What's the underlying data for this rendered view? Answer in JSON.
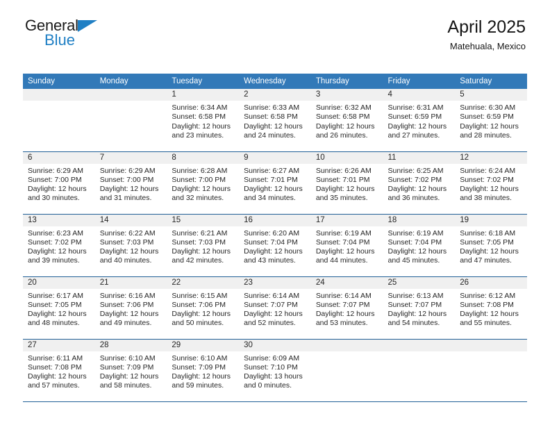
{
  "brand": {
    "name_top": "General",
    "name_bottom": "Blue",
    "color_dark": "#1a1a1a",
    "color_blue": "#1f7fc4"
  },
  "header": {
    "title": "April 2025",
    "subtitle": "Matehuala, Mexico"
  },
  "theme": {
    "header_row_bg": "#3279b8",
    "week_divider": "#205f96",
    "daynum_band_bg": "#f0f0f0",
    "text": "#252525"
  },
  "weekday_headers": [
    "Sunday",
    "Monday",
    "Tuesday",
    "Wednesday",
    "Thursday",
    "Friday",
    "Saturday"
  ],
  "labels": {
    "sunrise_prefix": "Sunrise:",
    "sunset_prefix": "Sunset:",
    "daylight_prefix": "Daylight:"
  },
  "weeks": [
    [
      {
        "day": "",
        "empty": true
      },
      {
        "day": "",
        "empty": true
      },
      {
        "day": "1",
        "sunrise": "Sunrise: 6:34 AM",
        "sunset": "Sunset: 6:58 PM",
        "daylight_line1": "Daylight: 12 hours",
        "daylight_line2": "and 23 minutes."
      },
      {
        "day": "2",
        "sunrise": "Sunrise: 6:33 AM",
        "sunset": "Sunset: 6:58 PM",
        "daylight_line1": "Daylight: 12 hours",
        "daylight_line2": "and 24 minutes."
      },
      {
        "day": "3",
        "sunrise": "Sunrise: 6:32 AM",
        "sunset": "Sunset: 6:58 PM",
        "daylight_line1": "Daylight: 12 hours",
        "daylight_line2": "and 26 minutes."
      },
      {
        "day": "4",
        "sunrise": "Sunrise: 6:31 AM",
        "sunset": "Sunset: 6:59 PM",
        "daylight_line1": "Daylight: 12 hours",
        "daylight_line2": "and 27 minutes."
      },
      {
        "day": "5",
        "sunrise": "Sunrise: 6:30 AM",
        "sunset": "Sunset: 6:59 PM",
        "daylight_line1": "Daylight: 12 hours",
        "daylight_line2": "and 28 minutes."
      }
    ],
    [
      {
        "day": "6",
        "sunrise": "Sunrise: 6:29 AM",
        "sunset": "Sunset: 7:00 PM",
        "daylight_line1": "Daylight: 12 hours",
        "daylight_line2": "and 30 minutes."
      },
      {
        "day": "7",
        "sunrise": "Sunrise: 6:29 AM",
        "sunset": "Sunset: 7:00 PM",
        "daylight_line1": "Daylight: 12 hours",
        "daylight_line2": "and 31 minutes."
      },
      {
        "day": "8",
        "sunrise": "Sunrise: 6:28 AM",
        "sunset": "Sunset: 7:00 PM",
        "daylight_line1": "Daylight: 12 hours",
        "daylight_line2": "and 32 minutes."
      },
      {
        "day": "9",
        "sunrise": "Sunrise: 6:27 AM",
        "sunset": "Sunset: 7:01 PM",
        "daylight_line1": "Daylight: 12 hours",
        "daylight_line2": "and 34 minutes."
      },
      {
        "day": "10",
        "sunrise": "Sunrise: 6:26 AM",
        "sunset": "Sunset: 7:01 PM",
        "daylight_line1": "Daylight: 12 hours",
        "daylight_line2": "and 35 minutes."
      },
      {
        "day": "11",
        "sunrise": "Sunrise: 6:25 AM",
        "sunset": "Sunset: 7:02 PM",
        "daylight_line1": "Daylight: 12 hours",
        "daylight_line2": "and 36 minutes."
      },
      {
        "day": "12",
        "sunrise": "Sunrise: 6:24 AM",
        "sunset": "Sunset: 7:02 PM",
        "daylight_line1": "Daylight: 12 hours",
        "daylight_line2": "and 38 minutes."
      }
    ],
    [
      {
        "day": "13",
        "sunrise": "Sunrise: 6:23 AM",
        "sunset": "Sunset: 7:02 PM",
        "daylight_line1": "Daylight: 12 hours",
        "daylight_line2": "and 39 minutes."
      },
      {
        "day": "14",
        "sunrise": "Sunrise: 6:22 AM",
        "sunset": "Sunset: 7:03 PM",
        "daylight_line1": "Daylight: 12 hours",
        "daylight_line2": "and 40 minutes."
      },
      {
        "day": "15",
        "sunrise": "Sunrise: 6:21 AM",
        "sunset": "Sunset: 7:03 PM",
        "daylight_line1": "Daylight: 12 hours",
        "daylight_line2": "and 42 minutes."
      },
      {
        "day": "16",
        "sunrise": "Sunrise: 6:20 AM",
        "sunset": "Sunset: 7:04 PM",
        "daylight_line1": "Daylight: 12 hours",
        "daylight_line2": "and 43 minutes."
      },
      {
        "day": "17",
        "sunrise": "Sunrise: 6:19 AM",
        "sunset": "Sunset: 7:04 PM",
        "daylight_line1": "Daylight: 12 hours",
        "daylight_line2": "and 44 minutes."
      },
      {
        "day": "18",
        "sunrise": "Sunrise: 6:19 AM",
        "sunset": "Sunset: 7:04 PM",
        "daylight_line1": "Daylight: 12 hours",
        "daylight_line2": "and 45 minutes."
      },
      {
        "day": "19",
        "sunrise": "Sunrise: 6:18 AM",
        "sunset": "Sunset: 7:05 PM",
        "daylight_line1": "Daylight: 12 hours",
        "daylight_line2": "and 47 minutes."
      }
    ],
    [
      {
        "day": "20",
        "sunrise": "Sunrise: 6:17 AM",
        "sunset": "Sunset: 7:05 PM",
        "daylight_line1": "Daylight: 12 hours",
        "daylight_line2": "and 48 minutes."
      },
      {
        "day": "21",
        "sunrise": "Sunrise: 6:16 AM",
        "sunset": "Sunset: 7:06 PM",
        "daylight_line1": "Daylight: 12 hours",
        "daylight_line2": "and 49 minutes."
      },
      {
        "day": "22",
        "sunrise": "Sunrise: 6:15 AM",
        "sunset": "Sunset: 7:06 PM",
        "daylight_line1": "Daylight: 12 hours",
        "daylight_line2": "and 50 minutes."
      },
      {
        "day": "23",
        "sunrise": "Sunrise: 6:14 AM",
        "sunset": "Sunset: 7:07 PM",
        "daylight_line1": "Daylight: 12 hours",
        "daylight_line2": "and 52 minutes."
      },
      {
        "day": "24",
        "sunrise": "Sunrise: 6:14 AM",
        "sunset": "Sunset: 7:07 PM",
        "daylight_line1": "Daylight: 12 hours",
        "daylight_line2": "and 53 minutes."
      },
      {
        "day": "25",
        "sunrise": "Sunrise: 6:13 AM",
        "sunset": "Sunset: 7:07 PM",
        "daylight_line1": "Daylight: 12 hours",
        "daylight_line2": "and 54 minutes."
      },
      {
        "day": "26",
        "sunrise": "Sunrise: 6:12 AM",
        "sunset": "Sunset: 7:08 PM",
        "daylight_line1": "Daylight: 12 hours",
        "daylight_line2": "and 55 minutes."
      }
    ],
    [
      {
        "day": "27",
        "sunrise": "Sunrise: 6:11 AM",
        "sunset": "Sunset: 7:08 PM",
        "daylight_line1": "Daylight: 12 hours",
        "daylight_line2": "and 57 minutes."
      },
      {
        "day": "28",
        "sunrise": "Sunrise: 6:10 AM",
        "sunset": "Sunset: 7:09 PM",
        "daylight_line1": "Daylight: 12 hours",
        "daylight_line2": "and 58 minutes."
      },
      {
        "day": "29",
        "sunrise": "Sunrise: 6:10 AM",
        "sunset": "Sunset: 7:09 PM",
        "daylight_line1": "Daylight: 12 hours",
        "daylight_line2": "and 59 minutes."
      },
      {
        "day": "30",
        "sunrise": "Sunrise: 6:09 AM",
        "sunset": "Sunset: 7:10 PM",
        "daylight_line1": "Daylight: 13 hours",
        "daylight_line2": "and 0 minutes."
      },
      {
        "day": "",
        "empty": true
      },
      {
        "day": "",
        "empty": true
      },
      {
        "day": "",
        "empty": true
      }
    ]
  ]
}
